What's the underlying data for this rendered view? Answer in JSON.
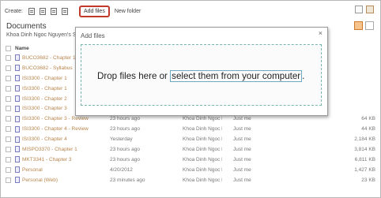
{
  "toolbar": {
    "create_label": "Create:",
    "add_files_label": "Add files",
    "new_folder_label": "New folder"
  },
  "header": {
    "title": "Documents",
    "owner": "Khoa Dinh Ngoc Nguyen's SkyDrive"
  },
  "table": {
    "name_header": "Name",
    "rows": [
      {
        "name": "BUCO3682 - Chapter 1",
        "modified": "",
        "by": "",
        "sharing": "",
        "size": ""
      },
      {
        "name": "BUCO3682 - Syllabus",
        "modified": "",
        "by": "",
        "sharing": "",
        "size": ""
      },
      {
        "name": "ISI3300 - Chapter 1",
        "modified": "",
        "by": "",
        "sharing": "",
        "size": ""
      },
      {
        "name": "ISI3300 - Chapter 1",
        "modified": "",
        "by": "",
        "sharing": "",
        "size": ""
      },
      {
        "name": "ISI3300 - Chapter 2",
        "modified": "",
        "by": "",
        "sharing": "",
        "size": ""
      },
      {
        "name": "ISI3300 - Chapter 3",
        "modified": "",
        "by": "",
        "sharing": "",
        "size": ""
      },
      {
        "name": "ISI3300 - Chapter 3 - Review",
        "modified": "23 hours ago",
        "by": "Khoa Dinh Ngoc N...",
        "sharing": "Just me",
        "size": "64 KB"
      },
      {
        "name": "ISI3300 - Chapter 4 - Review",
        "modified": "23 hours ago",
        "by": "Khoa Dinh Ngoc N...",
        "sharing": "Just me",
        "size": "44 KB"
      },
      {
        "name": "ISI3300 - Chapter 4",
        "modified": "Yesterday",
        "by": "Khoa Dinh Ngoc N...",
        "sharing": "Just me",
        "size": "2,184 KB"
      },
      {
        "name": "MISPO3370 - Chapter 1",
        "modified": "23 hours ago",
        "by": "Khoa Dinh Ngoc N...",
        "sharing": "Just me",
        "size": "3,814 KB"
      },
      {
        "name": "MKT3341 - Chapter 3",
        "modified": "23 hours ago",
        "by": "Khoa Dinh Ngoc N...",
        "sharing": "Just me",
        "size": "6,811 KB"
      },
      {
        "name": "Personal",
        "modified": "4/20/2012",
        "by": "Khoa Dinh Ngoc N...",
        "sharing": "Just me",
        "size": "1,427 KB"
      },
      {
        "name": "Personal (Web)",
        "modified": "23 minutes ago",
        "by": "Khoa Dinh Ngoc N...",
        "sharing": "Just me",
        "size": "23 KB"
      }
    ]
  },
  "modal": {
    "title": "Add files",
    "close": "×",
    "drop_text": "Drop files here or ",
    "select_link": "select them from your computer",
    "drop_suffix": "."
  }
}
